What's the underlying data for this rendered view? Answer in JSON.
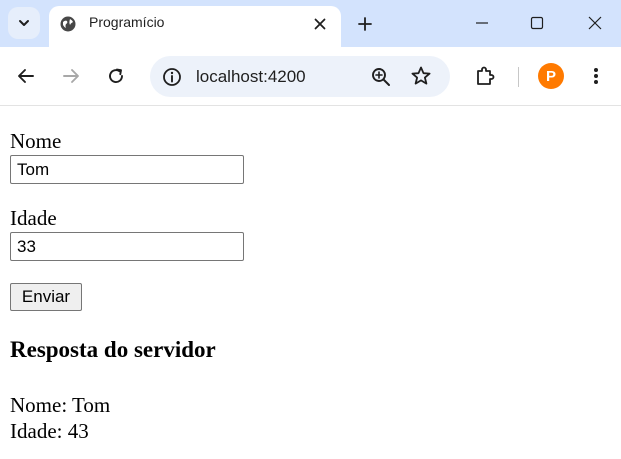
{
  "browser": {
    "tab_title": "Programício",
    "url": "localhost:4200",
    "avatar_letter": "P",
    "accent_color": "#d3e3fd",
    "avatar_color": "#ff7a00"
  },
  "form": {
    "name_label": "Nome",
    "name_value": "Tom",
    "age_label": "Idade",
    "age_value": "33",
    "submit_label": "Enviar"
  },
  "response": {
    "heading": "Resposta do servidor",
    "name_line": "Nome: Tom",
    "age_line": "Idade: 43"
  }
}
